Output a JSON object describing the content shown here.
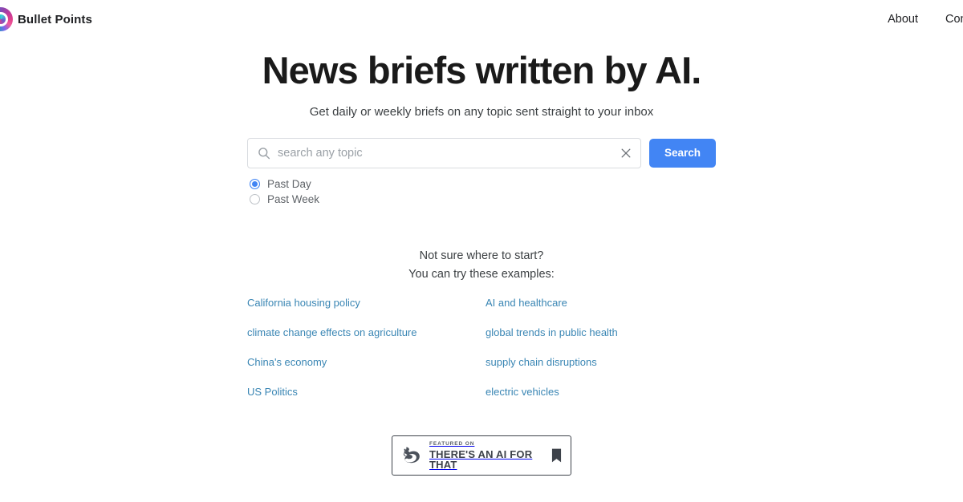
{
  "header": {
    "brand_name": "Bullet Points",
    "logo_icon": "bulletpoints-swirl-logo",
    "nav": [
      {
        "label": "About"
      },
      {
        "label": "Contact"
      }
    ]
  },
  "hero": {
    "title": "News briefs written by AI.",
    "subtitle": "Get daily or weekly briefs on any topic sent straight to your inbox"
  },
  "search": {
    "search_icon": "search-icon",
    "clear_icon": "close-icon",
    "placeholder": "search any topic",
    "value": "",
    "button_label": "Search",
    "button_color": "#4285f4"
  },
  "filters": {
    "options": [
      {
        "label": "Past Day",
        "selected": true
      },
      {
        "label": "Past Week",
        "selected": false
      }
    ]
  },
  "examples": {
    "prompt_line_1": "Not sure where to start?",
    "prompt_line_2": "You can try these examples:",
    "items": [
      {
        "label": "California housing policy"
      },
      {
        "label": "AI and healthcare"
      },
      {
        "label": "climate change effects on agriculture"
      },
      {
        "label": "global trends in public health"
      },
      {
        "label": "China's economy"
      },
      {
        "label": "supply chain disruptions"
      },
      {
        "label": "US Politics"
      },
      {
        "label": "electric vehicles"
      }
    ],
    "link_color": "#3a86b4"
  },
  "featured_badge": {
    "kicker": "FEATURED ON",
    "title": "THERE'S AN AI FOR THAT",
    "left_icon": "flexed-biceps-icon",
    "right_icon": "bookmark-icon",
    "border_color": "#3d424a"
  }
}
